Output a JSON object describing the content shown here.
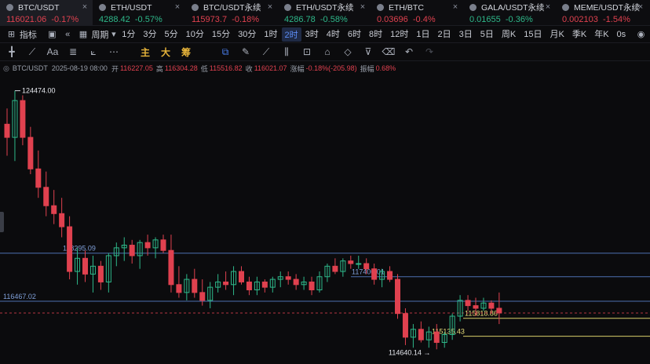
{
  "tickers": [
    {
      "name": "BTC/USDT",
      "price": "116021.06",
      "change": "-0.17%",
      "dir": "dn",
      "active": true
    },
    {
      "name": "ETH/USDT",
      "price": "4288.42",
      "change": "-0.57%",
      "dir": "up",
      "active": false
    },
    {
      "name": "BTC/USDT永续",
      "price": "115973.7",
      "change": "-0.18%",
      "dir": "dn",
      "active": false
    },
    {
      "name": "ETH/USDT永续",
      "price": "4286.78",
      "change": "-0.58%",
      "dir": "up",
      "active": false
    },
    {
      "name": "ETH/BTC",
      "price": "0.03696",
      "change": "-0.4%",
      "dir": "dn",
      "active": false
    },
    {
      "name": "GALA/USDT永续",
      "price": "0.01655",
      "change": "-0.36%",
      "dir": "up",
      "active": false
    },
    {
      "name": "MEME/USDT永续",
      "price": "0.002103",
      "change": "-1.54%",
      "dir": "dn",
      "active": false
    }
  ],
  "timeframe": {
    "indicator_label": "指标",
    "period_label": "周期",
    "items": [
      "1分",
      "3分",
      "5分",
      "10分",
      "15分",
      "30分",
      "1时",
      "2时",
      "3时",
      "4时",
      "6时",
      "8时",
      "12时",
      "1日",
      "2日",
      "3日",
      "5日",
      "周K",
      "15日",
      "月K",
      "季K",
      "年K"
    ],
    "selected": "2时",
    "right_label": "0s"
  },
  "drawing_tools": {
    "text_label": "Aa",
    "main_label": "主",
    "big_label": "大",
    "chip_label": "筹"
  },
  "ohlc": {
    "symbol": "BTC/USDT",
    "time": "2025-08-19 08:00",
    "open_label": "开",
    "open": "116227.05",
    "high_label": "高",
    "high": "116304.28",
    "low_label": "低",
    "low": "115516.82",
    "close_label": "收",
    "close": "116021.07",
    "chg_label": "涨幅",
    "chg": "-0.18%(-205.98)",
    "amp_label": "振幅",
    "amp": "0.68%"
  },
  "colors": {
    "up": "#2eb88a",
    "down": "#e0414f",
    "blue_line": "#4c6fb0",
    "yellow_line": "#d8cf6a",
    "accent": "#4a7ff0"
  },
  "chart_data": {
    "type": "candlestick",
    "candles": [
      [
        123200,
        123800,
        122000,
        122700
      ],
      [
        122700,
        124474,
        121800,
        124100
      ],
      [
        124100,
        124300,
        122400,
        122700
      ],
      [
        122700,
        123100,
        121300,
        121500
      ],
      [
        121500,
        122200,
        120400,
        120800
      ],
      [
        120800,
        121400,
        119700,
        120100
      ],
      [
        120100,
        120700,
        119400,
        119800
      ],
      [
        119800,
        120400,
        118900,
        119300
      ],
      [
        119300,
        119700,
        117300,
        117600
      ],
      [
        117600,
        118500,
        117100,
        118100
      ],
      [
        118100,
        118400,
        117200,
        117500
      ],
      [
        117500,
        118200,
        116800,
        117800
      ],
      [
        117800,
        118000,
        116900,
        117200
      ],
      [
        117200,
        118300,
        116800,
        118200
      ],
      [
        118200,
        118700,
        117800,
        118500
      ],
      [
        118500,
        118900,
        118000,
        118600
      ],
      [
        118600,
        118800,
        117900,
        118200
      ],
      [
        118200,
        118800,
        117700,
        118700
      ],
      [
        118700,
        119000,
        118200,
        118500
      ],
      [
        118500,
        118900,
        118100,
        118800
      ],
      [
        118800,
        119000,
        118300,
        118400
      ],
      [
        118400,
        119000,
        116800,
        117100
      ],
      [
        117100,
        117800,
        116600,
        116800
      ],
      [
        116800,
        117500,
        116500,
        117300
      ],
      [
        117300,
        117700,
        116600,
        116800
      ],
      [
        116800,
        117300,
        116300,
        116500
      ],
      [
        116500,
        117200,
        116200,
        117000
      ],
      [
        117000,
        117500,
        116800,
        117200
      ],
      [
        117200,
        117600,
        116900,
        117100
      ],
      [
        117100,
        117800,
        116700,
        117600
      ],
      [
        117600,
        117800,
        117100,
        117200
      ],
      [
        117200,
        117400,
        116700,
        116900
      ],
      [
        116900,
        117400,
        116700,
        117200
      ],
      [
        117200,
        117300,
        116800,
        117000
      ],
      [
        117000,
        117400,
        116800,
        117300
      ],
      [
        117300,
        117600,
        117000,
        117400
      ],
      [
        117400,
        117600,
        117100,
        117300
      ],
      [
        117300,
        117500,
        116900,
        117100
      ],
      [
        117100,
        117400,
        116900,
        117200
      ],
      [
        117200,
        117400,
        116700,
        116900
      ],
      [
        116900,
        117600,
        116800,
        117400
      ],
      [
        117400,
        117900,
        117200,
        117800
      ],
      [
        117800,
        118100,
        117500,
        117600
      ],
      [
        117600,
        118100,
        117400,
        118000
      ],
      [
        118000,
        118200,
        117700,
        117900
      ],
      [
        117900,
        118200,
        117700,
        117900
      ],
      [
        117900,
        118100,
        117500,
        117700
      ],
      [
        117700,
        117900,
        117100,
        117300
      ],
      [
        117300,
        117700,
        117000,
        117600
      ],
      [
        117600,
        117800,
        117200,
        117300
      ],
      [
        117300,
        117500,
        115800,
        116000
      ],
      [
        116000,
        116200,
        114800,
        115100
      ],
      [
        115100,
        115600,
        114700,
        115400
      ],
      [
        115400,
        115700,
        114900,
        115000
      ],
      [
        115000,
        115500,
        114700,
        115300
      ],
      [
        115300,
        115600,
        114640,
        114900
      ],
      [
        114900,
        115300,
        114700,
        115200
      ],
      [
        115200,
        116000,
        115000,
        115900
      ],
      [
        115900,
        116700,
        115700,
        116500
      ],
      [
        116500,
        116700,
        116100,
        116300
      ],
      [
        116300,
        116600,
        115900,
        116200
      ],
      [
        116200,
        116600,
        116100,
        116400
      ],
      [
        116400,
        116500,
        116000,
        116200
      ],
      [
        116200,
        116800,
        115600,
        116021
      ]
    ],
    "price_lines": [
      {
        "price": 118295.09,
        "label": "118295.09",
        "style": "solid",
        "color": "#4c6fb0"
      },
      {
        "price": 117400.01,
        "label": "117400.01",
        "style": "solid",
        "color": "#4c6fb0"
      },
      {
        "price": 116467.02,
        "label": "116467.02",
        "style": "solid",
        "color": "#4c6fb0"
      },
      {
        "price": 115818.86,
        "label": "115818.86",
        "style": "solid",
        "color": "#d8cf6a"
      },
      {
        "price": 115135.43,
        "label": "115135.43",
        "style": "solid",
        "color": "#d8cf6a"
      }
    ],
    "current_price": 116021.06,
    "high_marker": {
      "label": "124474.00",
      "price": 124474
    },
    "low_marker": {
      "label": "114640.14",
      "price": 114640
    }
  }
}
